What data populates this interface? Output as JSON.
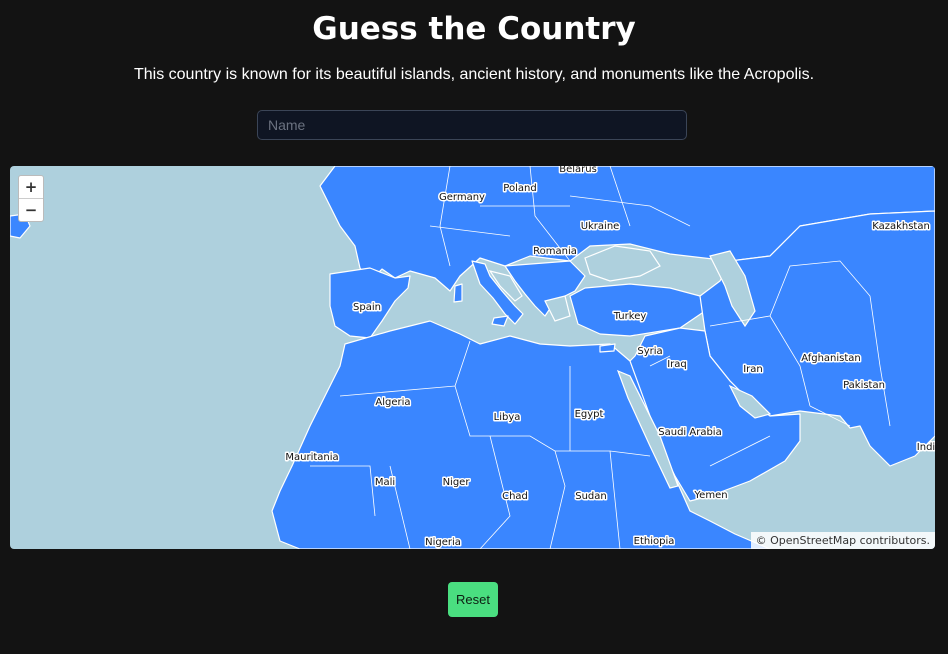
{
  "game": {
    "title": "Guess the Country",
    "hint": "This country is known for its beautiful islands, ancient history, and monuments like the Acropolis.",
    "input_placeholder": "Name",
    "input_value": "",
    "reset_label": "Reset"
  },
  "map": {
    "zoom_in_label": "+",
    "zoom_out_label": "−",
    "attribution": "© OpenStreetMap contributors.",
    "land_color": "#3a86ff",
    "water_color": "#aed0dd",
    "country_labels": [
      "Belarus",
      "Poland",
      "Germany",
      "Ukraine",
      "Kazakhstan",
      "Romania",
      "Spain",
      "Turkey",
      "Syria",
      "Iraq",
      "Iran",
      "Afghanistan",
      "Pakistan",
      "Algeria",
      "Libya",
      "Egypt",
      "Saudi Arabia",
      "Mauritania",
      "Mali",
      "Niger",
      "Chad",
      "Sudan",
      "Yemen",
      "Nigeria",
      "Ethiopia",
      "Indi"
    ]
  },
  "colors": {
    "background": "#131313",
    "button": "#4ade80"
  }
}
